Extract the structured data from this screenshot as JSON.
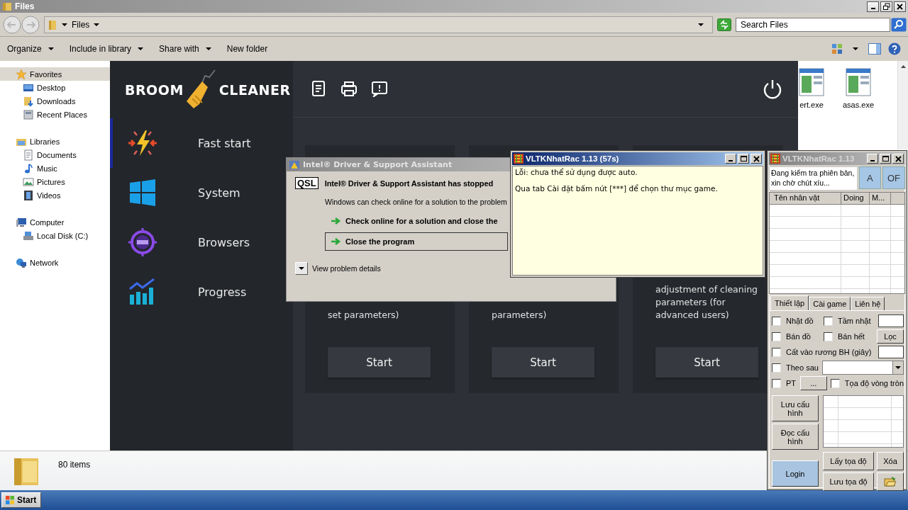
{
  "explorer": {
    "title": "Files",
    "breadcrumb": "Files",
    "search_placeholder": "Search Files",
    "toolbar": [
      {
        "label": "Organize",
        "dropdown": true
      },
      {
        "label": "Include in library",
        "dropdown": true
      },
      {
        "label": "Share with",
        "dropdown": true
      },
      {
        "label": "New folder",
        "dropdown": false
      }
    ],
    "nav": [
      {
        "label": "Favorites",
        "kind": "star",
        "selected": true,
        "children": [
          {
            "label": "Desktop",
            "kind": "desktop",
            "selected": false
          },
          {
            "label": "Downloads",
            "kind": "downloads",
            "selected": false
          },
          {
            "label": "Recent Places",
            "kind": "recent",
            "selected": false
          }
        ]
      },
      {
        "label": "Libraries",
        "kind": "libraries",
        "selected": false,
        "children": [
          {
            "label": "Documents",
            "kind": "documents",
            "selected": false
          },
          {
            "label": "Music",
            "kind": "music",
            "selected": false
          },
          {
            "label": "Pictures",
            "kind": "pictures",
            "selected": false
          },
          {
            "label": "Videos",
            "kind": "videos",
            "selected": false
          }
        ]
      },
      {
        "label": "Computer",
        "kind": "computer",
        "selected": false,
        "children": [
          {
            "label": "Local Disk (C:)",
            "kind": "disk",
            "selected": false
          }
        ]
      },
      {
        "label": "Network",
        "kind": "network",
        "selected": false
      }
    ],
    "files": [
      {
        "name": "ert.exe"
      },
      {
        "name": "asas.exe"
      }
    ],
    "status": "80 items"
  },
  "broom": {
    "logo": [
      "BROOM",
      "CLEANER"
    ],
    "menu": [
      {
        "label": "Fast start",
        "kind": "bolt",
        "selected": true
      },
      {
        "label": "System",
        "kind": "windows",
        "selected": false
      },
      {
        "label": "Browsers",
        "kind": "com",
        "selected": false
      },
      {
        "label": "Progress",
        "kind": "chart",
        "selected": false
      }
    ],
    "cards": [
      {
        "text": "set parameters)",
        "button": "Start"
      },
      {
        "text": "parameters)",
        "button": "Start"
      },
      {
        "text": "adjustment of cleaning parameters (for advanced users)",
        "button": "Start"
      }
    ]
  },
  "error_dialog": {
    "title": "Intel® Driver & Support Assistant",
    "badge": "QSL",
    "heading": "Intel® Driver & Support Assistant has stopped",
    "message": "Windows can check online for a solution to the problem",
    "options": [
      {
        "label": "Check online for a solution and close the",
        "selected": false
      },
      {
        "label": "Close the program",
        "selected": true
      }
    ],
    "details": "View problem details"
  },
  "log_window": {
    "title": "VLTKNhatRac 1.13 (57s)",
    "lines": [
      "Lỗi: chưa thể sử dụng được auto.",
      "Qua tab Cài đặt bấm nút [***] để chọn thư mục game."
    ]
  },
  "tool_window": {
    "title": "VLTKNhatRac 1.13",
    "status": "Đang kiểm tra phiên bản, xin chờ chút xíu...",
    "mode_buttons": [
      "A",
      "OF"
    ],
    "columns": [
      "Tên nhân vật",
      "Doing",
      "M..."
    ],
    "tabs": [
      {
        "label": "Thiết lập",
        "selected": true
      },
      {
        "label": "Cài game",
        "selected": false
      },
      {
        "label": "Liên hệ",
        "selected": false
      }
    ],
    "option_rows": [
      [
        {
          "kind": "checkbox",
          "label": "Nhặt đồ",
          "checked": false
        },
        {
          "kind": "checkbox",
          "label": "Tầm nhặt",
          "checked": false
        },
        {
          "kind": "input"
        }
      ],
      [
        {
          "kind": "checkbox",
          "label": "Bán đồ",
          "checked": false
        },
        {
          "kind": "checkbox",
          "label": "Bán hết",
          "checked": false
        },
        {
          "kind": "button",
          "label": "Lọc"
        }
      ],
      [
        {
          "kind": "checkbox",
          "label": "Cất vào rương BH (giây)",
          "checked": false
        },
        {
          "kind": "input"
        }
      ],
      [
        {
          "kind": "checkbox",
          "label": "Theo sau",
          "checked": false
        },
        {
          "kind": "select"
        }
      ],
      [
        {
          "kind": "checkbox",
          "label": "PT",
          "checked": false
        },
        {
          "kind": "button",
          "label": "..."
        },
        {
          "kind": "checkbox",
          "label": "Tọa độ vòng tròn",
          "checked": false
        }
      ]
    ],
    "config_buttons": [
      "Lưu cấu hình",
      "Đọc cấu hình"
    ],
    "login": "Login",
    "coord_buttons": [
      "Lấy tọa độ",
      "Xóa",
      "Lưu tọa độ"
    ]
  },
  "taskbar": {
    "start": "Start"
  }
}
